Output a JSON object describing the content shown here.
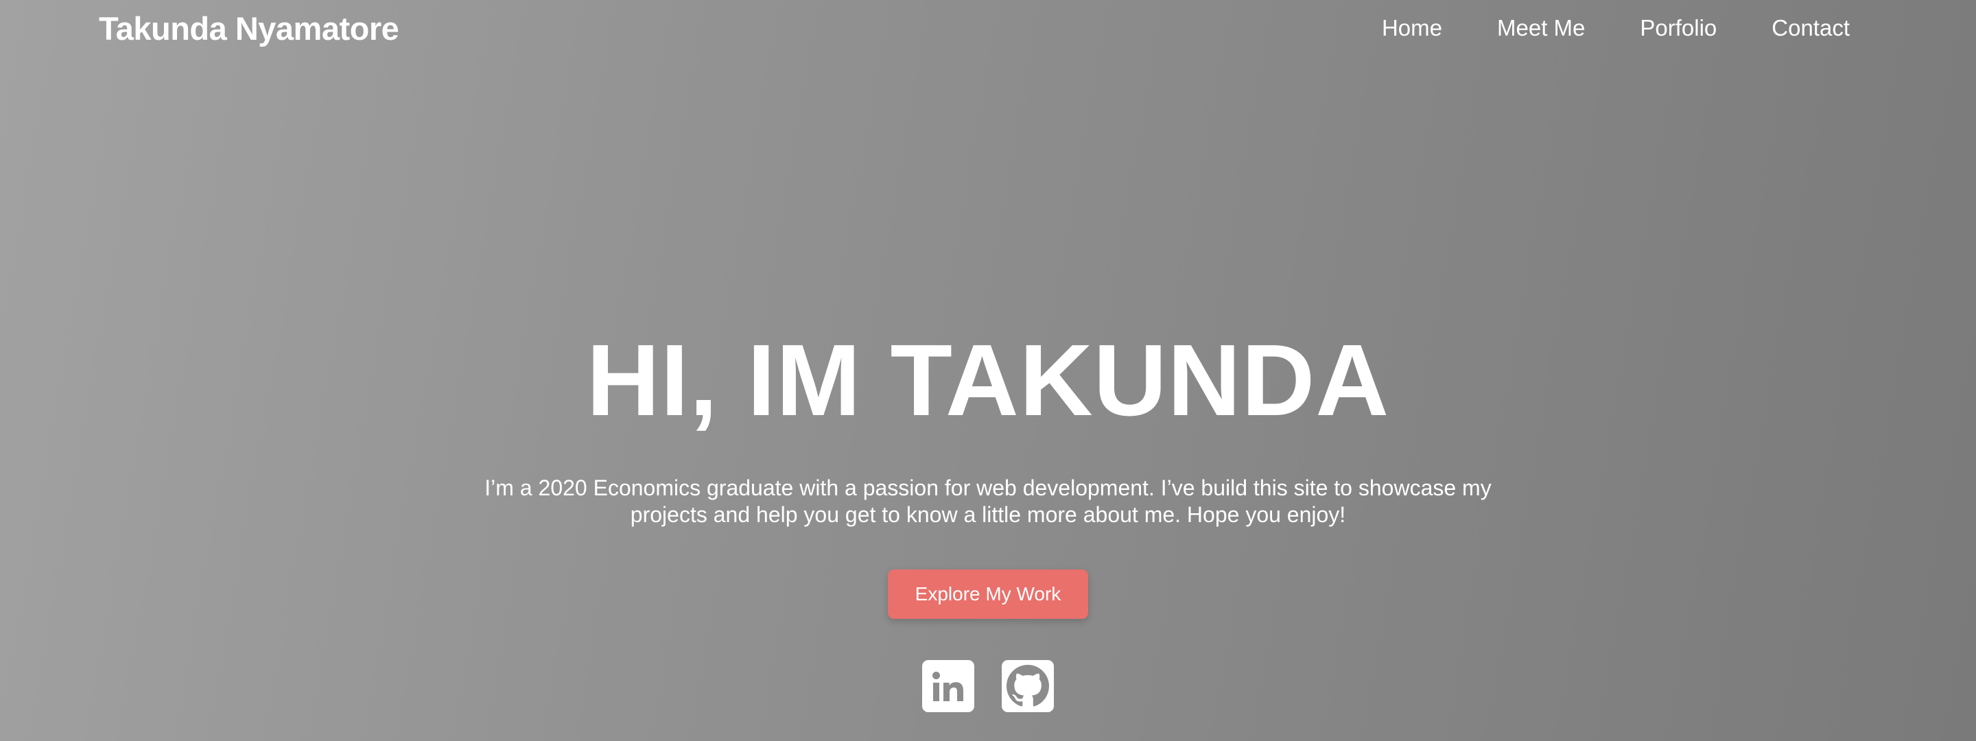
{
  "brand": {
    "name": "Takunda Nyamatore"
  },
  "nav": {
    "items": [
      {
        "label": "Home"
      },
      {
        "label": "Meet Me"
      },
      {
        "label": "Porfolio"
      },
      {
        "label": "Contact"
      }
    ]
  },
  "hero": {
    "title": "HI, IM TAKUNDA",
    "description": "I’m a 2020 Economics graduate with a passion for web development. I’ve build this site to showcase my projects and help you get to know a little more about me. Hope you enjoy!",
    "cta_label": "Explore My Work"
  },
  "socials": [
    {
      "icon": "linkedin-icon"
    },
    {
      "icon": "github-icon"
    }
  ],
  "colors": {
    "accent": "#e9706b",
    "background_start": "#a2a2a2",
    "background_end": "#7a7a7a",
    "text": "#ffffff"
  }
}
